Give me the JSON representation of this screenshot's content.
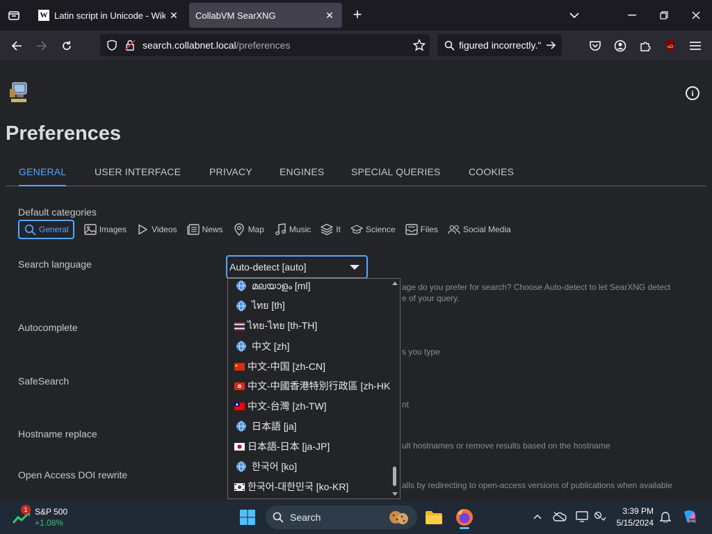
{
  "browser": {
    "tabs": [
      {
        "title": "Latin script in Unicode - Wikipe",
        "favicon": "W",
        "active": false
      },
      {
        "title": "CollabVM SearXNG",
        "active": true
      }
    ],
    "url_host": "search.collabnet.local",
    "url_path": "/preferences",
    "search_text": "figured incorrectly.\""
  },
  "page": {
    "title": "Preferences",
    "tabs": [
      "GENERAL",
      "USER INTERFACE",
      "PRIVACY",
      "ENGINES",
      "SPECIAL QUERIES",
      "COOKIES"
    ],
    "active_tab": "GENERAL",
    "default_categories_label": "Default categories",
    "categories": [
      {
        "label": "General",
        "icon": "search-icon",
        "active": true
      },
      {
        "label": "Images",
        "icon": "image-icon"
      },
      {
        "label": "Videos",
        "icon": "play-icon"
      },
      {
        "label": "News",
        "icon": "newspaper-icon"
      },
      {
        "label": "Map",
        "icon": "map-pin-icon"
      },
      {
        "label": "Music",
        "icon": "music-note-icon"
      },
      {
        "label": "It",
        "icon": "layers-icon"
      },
      {
        "label": "Science",
        "icon": "graduation-cap-icon"
      },
      {
        "label": "Files",
        "icon": "file-tray-icon"
      },
      {
        "label": "Social Media",
        "icon": "people-icon"
      }
    ],
    "search_language_label": "Search language",
    "search_language_value": "Auto-detect [auto]",
    "search_language_desc_1": "age do you prefer for search? Choose Auto-detect to let SearXNG detect",
    "search_language_desc_2": "e of your query.",
    "autocomplete_label": "Autocomplete",
    "autocomplete_desc": "s you type",
    "safesearch_label": "SafeSearch",
    "safesearch_desc": "nt",
    "hostname_label": "Hostname replace",
    "hostname_desc": "ult hostnames or remove results based on the hostname",
    "doi_label": "Open Access DOI rewrite",
    "doi_desc": "alls by redirecting to open-access versions of publications when available"
  },
  "language_options": [
    {
      "label": "മലയാളം [ml]",
      "marker": "globe"
    },
    {
      "label": "ไทย [th]",
      "marker": "globe"
    },
    {
      "label": "ไทย-ไทย [th-TH]",
      "marker": "flag-th"
    },
    {
      "label": "中文 [zh]",
      "marker": "globe"
    },
    {
      "label": "中文-中国 [zh-CN]",
      "marker": "flag-cn"
    },
    {
      "label": "中文-中國香港特別行政區 [zh-HK]",
      "marker": "flag-hk"
    },
    {
      "label": "中文-台灣 [zh-TW]",
      "marker": "flag-tw"
    },
    {
      "label": "日本語 [ja]",
      "marker": "globe"
    },
    {
      "label": "日本語-日本 [ja-JP]",
      "marker": "flag-jp"
    },
    {
      "label": "한국어 [ko]",
      "marker": "globe"
    },
    {
      "label": "한국어-대한민국 [ko-KR]",
      "marker": "flag-kr"
    }
  ],
  "taskbar": {
    "stock_name": "S&P 500",
    "stock_change": "+1.08%",
    "stock_badge": "1",
    "search_label": "Search",
    "time": "3:39 PM",
    "date": "5/15/2024"
  },
  "colors": {
    "accent": "#58a6ff",
    "page_bg": "#222428"
  }
}
